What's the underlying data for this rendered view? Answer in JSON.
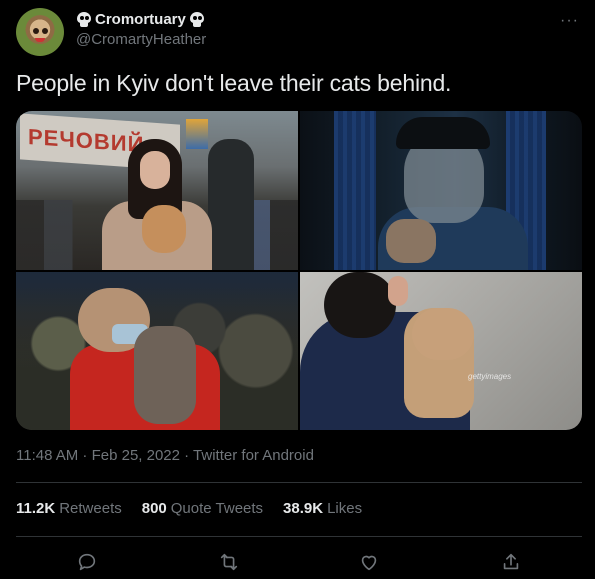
{
  "user": {
    "display_name": "Cromortuary",
    "handle": "@CromartyHeather"
  },
  "more_label": "···",
  "tweet": {
    "text": "People in Kyiv don't leave their cats behind."
  },
  "media": {
    "photo_sign_text": "РЕЧОВИЙ",
    "watermark": "gettyimages"
  },
  "meta": {
    "line": "11:48 AM · Feb 25, 2022 · Twitter for Android"
  },
  "stats": {
    "retweets_count": "11.2K",
    "retweets_label": "Retweets",
    "quotes_count": "800",
    "quotes_label": "Quote Tweets",
    "likes_count": "38.9K",
    "likes_label": "Likes"
  },
  "actions": {
    "reply": "reply-icon",
    "retweet": "retweet-icon",
    "like": "heart-icon",
    "share": "share-icon"
  },
  "colors": {
    "background": "#000000",
    "primary_text": "#e7e9ea",
    "secondary_text": "#71767b",
    "divider": "#2f3336"
  }
}
